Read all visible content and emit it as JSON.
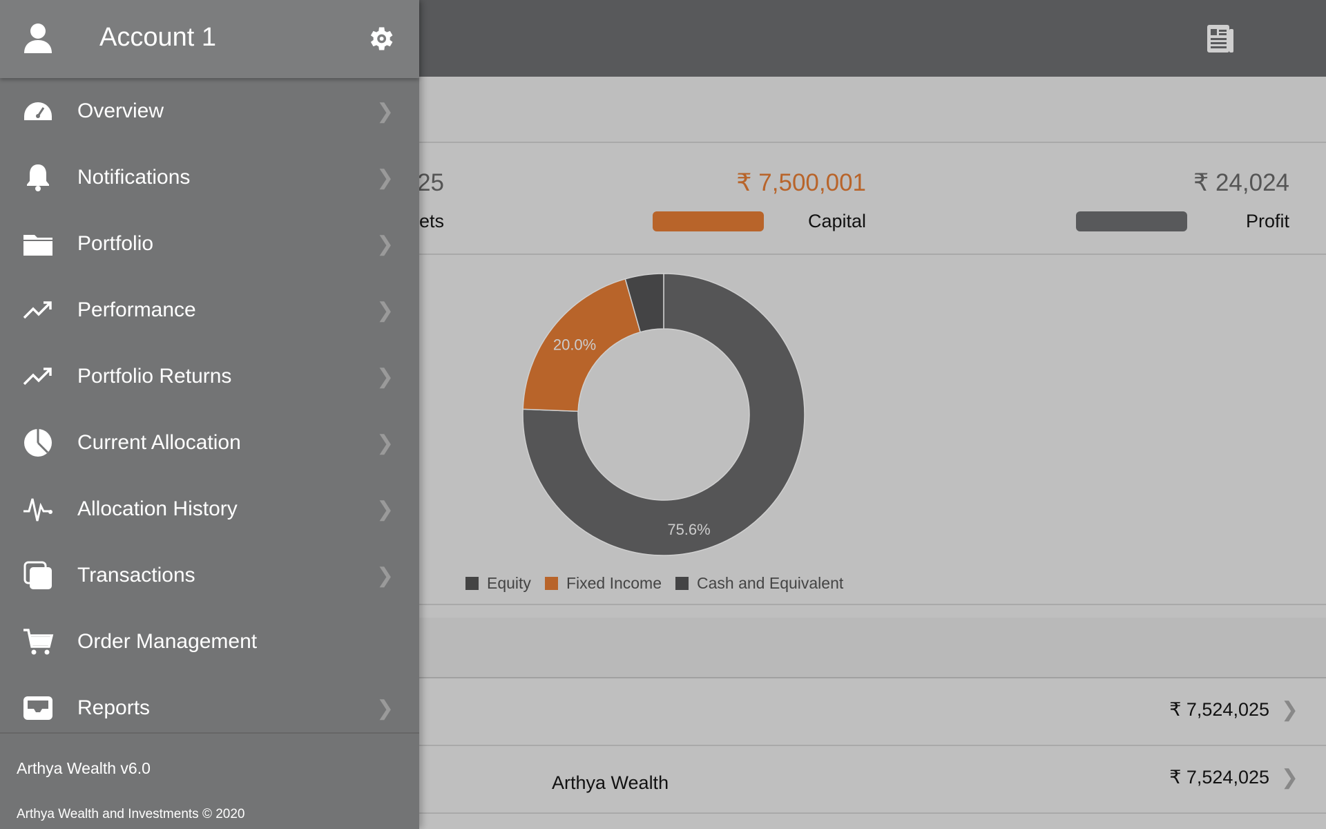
{
  "header": {
    "icon": "newspaper-icon"
  },
  "summary": {
    "assets_value_partial": "25",
    "assets_label_partial": "ets",
    "capital_value": "₹ 7,500,001",
    "capital_label": "Capital",
    "profit_value": "₹ 24,024",
    "profit_label": "Profit",
    "colors": {
      "capital": "#b8642a",
      "profit": "#58595b"
    }
  },
  "chart_data": {
    "type": "pie",
    "donut": true,
    "categories": [
      "Equity",
      "Fixed Income",
      "Cash and Equivalent"
    ],
    "values": [
      75.6,
      20.0,
      4.4
    ],
    "data_labels": [
      "75.6%",
      "20.0%",
      ""
    ],
    "colors": [
      "#555556",
      "#b8642a",
      "#444445"
    ],
    "legend": "bottom"
  },
  "rows": [
    {
      "name": "",
      "amount": "₹ 7,524,025"
    },
    {
      "name": "Arthya Wealth",
      "amount": "₹ 7,524,025"
    }
  ],
  "sidebar": {
    "account": "Account 1",
    "items": [
      {
        "label": "Overview",
        "icon": "dashboard-icon",
        "chevron": true
      },
      {
        "label": "Notifications",
        "icon": "bell-icon",
        "chevron": true
      },
      {
        "label": "Portfolio",
        "icon": "folder-icon",
        "chevron": true
      },
      {
        "label": "Performance",
        "icon": "trending-up-icon",
        "chevron": true
      },
      {
        "label": "Portfolio Returns",
        "icon": "trending-up-icon",
        "chevron": true
      },
      {
        "label": "Current Allocation",
        "icon": "pie-chart-icon",
        "chevron": true
      },
      {
        "label": "Allocation History",
        "icon": "pulse-icon",
        "chevron": true
      },
      {
        "label": "Transactions",
        "icon": "copy-icon",
        "chevron": true
      },
      {
        "label": "Order Management",
        "icon": "cart-icon",
        "chevron": false
      },
      {
        "label": "Reports",
        "icon": "inbox-icon",
        "chevron": true
      }
    ],
    "version": "Arthya Wealth v6.0",
    "copyright": "Arthya Wealth and Investments © 2020"
  }
}
